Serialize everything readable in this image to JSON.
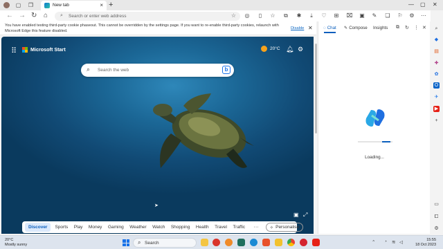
{
  "browser": {
    "tab_title": "New tab",
    "address_placeholder": "Search or enter web address",
    "icons": [
      "sidebar-toggle-icon",
      "workspaces-icon",
      "back-icon",
      "refresh-icon",
      "home-icon",
      "favorite-star-icon"
    ]
  },
  "infobar": {
    "message": "You have enabled testing third-party cookie phaseout. This cannot be overridden by the settings page. If you want to re-enable third-party cookies, relaunch with Microsoft Edge this feature disabled.",
    "disable_label": "Disable"
  },
  "newtab": {
    "brand": "Microsoft Start",
    "temperature": "20°C",
    "search_placeholder": "Search the web",
    "nav_items": [
      "Discover",
      "Sports",
      "Play",
      "Money",
      "Gaming",
      "Weather",
      "Watch",
      "Shopping",
      "Health",
      "Travel",
      "Traffic"
    ],
    "nav_more": "···",
    "personalise_label": "Personalise"
  },
  "sidepanel": {
    "tabs": {
      "chat": "Chat",
      "compose": "Compose",
      "insights": "Insights"
    },
    "loading_text": "Loading...",
    "loading_progress": 0.25
  },
  "taskbar": {
    "weather_temp": "20°C",
    "weather_desc": "Mostly sunny",
    "search_label": "Search",
    "time": "15:55",
    "date": "18 Oct 2023"
  },
  "colors": {
    "accent": "#0a5ebd",
    "ocean_top": "#2e87b9",
    "ocean_bottom": "#0a3a5e",
    "sun": "#f7a21b"
  }
}
